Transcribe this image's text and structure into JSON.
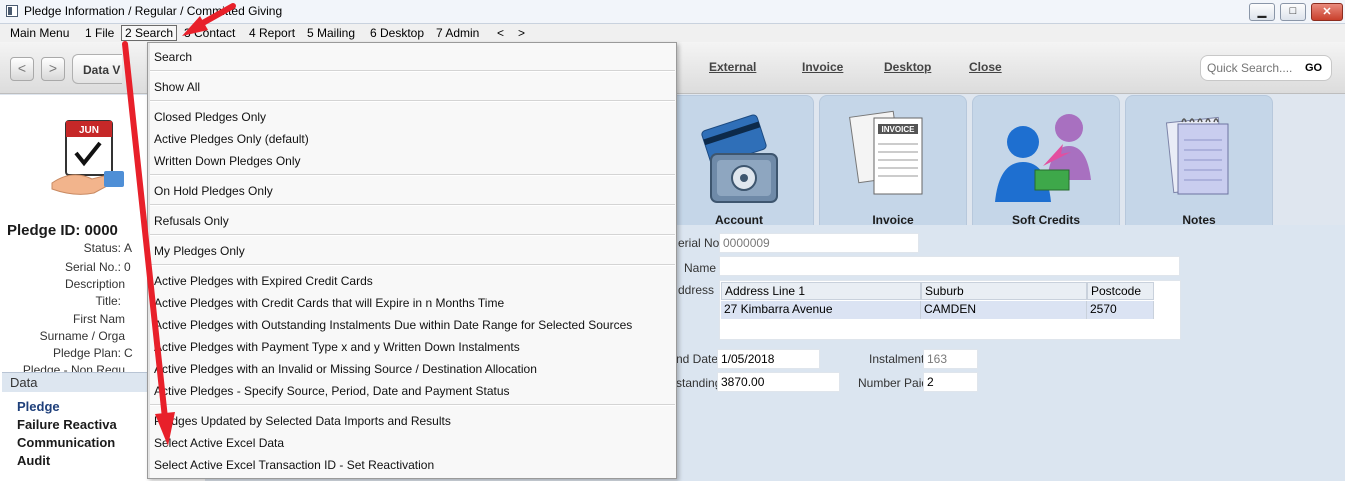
{
  "window": {
    "title": "Pledge Information / Regular / Committed Giving",
    "min_glyph": "▁",
    "max_glyph": "□",
    "close_glyph": "✕"
  },
  "menubar": {
    "items": [
      "Main Menu",
      "1 File",
      "2 Search",
      "3 Contact",
      "4 Report",
      "5 Mailing",
      "6 Desktop",
      "7 Admin",
      "<",
      ">"
    ]
  },
  "toolbar": {
    "back": "<",
    "forward": ">",
    "dataview_tab": "Data V",
    "links": [
      "External",
      "Invoice",
      "Desktop",
      "Close"
    ],
    "quick_search_placeholder": "Quick Search....",
    "go_label": "GO"
  },
  "left_panel": {
    "pledge_id": "Pledge ID: 0000",
    "fields": [
      {
        "label": "Status:",
        "value": "A"
      },
      {
        "label": "Serial No.:",
        "value": "0"
      },
      {
        "label": "Description",
        "value": ""
      },
      {
        "label": "Title:",
        "value": ""
      },
      {
        "label": "First Nam",
        "value": ""
      },
      {
        "label": "Surname / Orga",
        "value": ""
      },
      {
        "label": "Pledge Plan:",
        "value": "C"
      },
      {
        "label": "Pledge - Non Regu",
        "value": ""
      }
    ],
    "data_header": "Data",
    "data_items": [
      "Pledge",
      "Failure Reactiva",
      "Communication",
      "Audit"
    ]
  },
  "tiles": [
    {
      "label": "Account",
      "icon": "credit-card-safe-icon"
    },
    {
      "label": "Invoice",
      "icon": "invoice-documents-icon"
    },
    {
      "label": "Soft Credits",
      "icon": "people-transfer-icon"
    },
    {
      "label": "Notes",
      "icon": "notepad-icon"
    }
  ],
  "form": {
    "serial_label": "erial No.",
    "serial_value": "0000009",
    "name_label": "Name",
    "name_value": "",
    "address_label": "ddress",
    "address_headers": [
      "Address Line 1",
      "Suburb",
      "Postcode"
    ],
    "address_row": [
      "27 Kimbarra Avenue",
      "CAMDEN",
      "2570"
    ],
    "end_date_label": "nd Date",
    "end_date_value": "1/05/2018",
    "outstanding_label": "standing",
    "outstanding_value": "3870.00",
    "instalments_label": "Instalments",
    "instalments_value": "163",
    "number_paid_label": "Number Paid",
    "number_paid_value": "2"
  },
  "search_menu": {
    "groups": [
      [
        "Search"
      ],
      [
        "Show All"
      ],
      [
        "Closed Pledges Only",
        "Active Pledges Only (default)",
        "Written Down Pledges Only"
      ],
      [
        "On Hold Pledges Only"
      ],
      [
        "Refusals Only"
      ],
      [
        "My Pledges Only"
      ],
      [
        "Active Pledges with Expired Credit Cards",
        "Active Pledges with Credit Cards that will Expire in n Months Time",
        "Active Pledges with Outstanding Instalments Due within Date Range for Selected Sources",
        "Active Pledges with Payment Type x and y Written Down Instalments",
        "Active Pledges with an Invalid or Missing Source / Destination Allocation",
        "Active Pledges - Specify Source, Period, Date and Payment Status"
      ],
      [
        "Pledges Updated by Selected Data Imports and Results",
        "Select Active Excel Data",
        "Select Active Excel Transaction ID - Set Reactivation"
      ]
    ]
  },
  "colors": {
    "annotation_arrow": "#e8202a",
    "tile_bg": "#c5d6e8",
    "form_bg": "#dbe5f0",
    "title_link": "#1e3f7a"
  }
}
